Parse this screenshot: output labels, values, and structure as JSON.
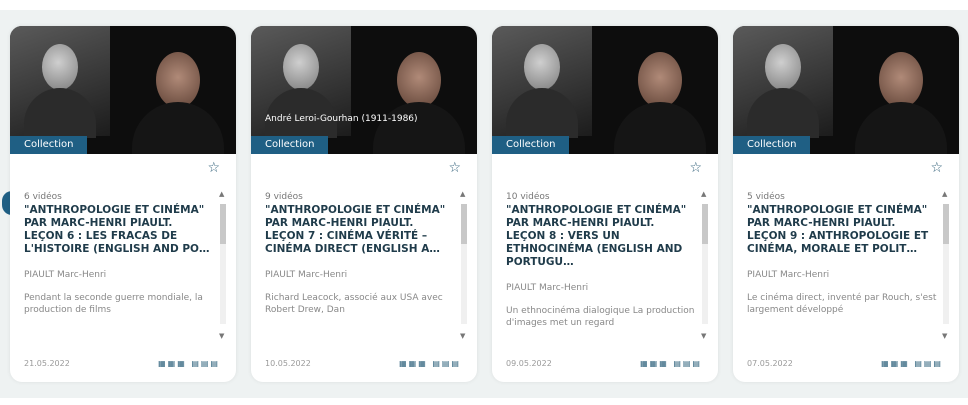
{
  "cards": [
    {
      "tag": "Collection",
      "caption": "",
      "count": "6 vidéos",
      "title": "\"ANTHROPOLOGIE ET CINÉMA\" PAR MARC-HENRI PIAULT. LEÇON 6 : LES FRACAS DE L'HISTOIRE (ENGLISH AND PO…",
      "author": "PIAULT Marc-Henri",
      "desc": "Pendant la seconde guerre mondiale, la production de films",
      "date": "21.05.2022"
    },
    {
      "tag": "Collection",
      "caption": "André Leroi-Gourhan (1911-1986)",
      "count": "9 vidéos",
      "title": "\"ANTHROPOLOGIE ET CINÉMA\" PAR MARC-HENRI PIAULT. LEÇON 7 : CINÉMA VÉRITÉ – CINÉMA DIRECT (ENGLISH A…",
      "author": "PIAULT Marc-Henri",
      "desc": "Richard Leacock, associé aux USA avec Robert Drew, Dan",
      "date": "10.05.2022"
    },
    {
      "tag": "Collection",
      "caption": "",
      "count": "10 vidéos",
      "title": "\"ANTHROPOLOGIE ET CINÉMA\" PAR MARC-HENRI PIAULT. LEÇON 8 : VERS UN ETHNOCINÉMA (ENGLISH AND PORTUGU…",
      "author": "PIAULT Marc-Henri",
      "desc": "Un ethnocinéma dialogique La production d'images met un regard",
      "date": "09.05.2022"
    },
    {
      "tag": "Collection",
      "caption": "",
      "count": "5 vidéos",
      "title": "\"ANTHROPOLOGIE ET CINÉMA\" PAR MARC-HENRI PIAULT. LEÇON 9 : ANTHROPOLOGIE ET CINÉMA, MORALE ET POLIT…",
      "author": "PIAULT Marc-Henri",
      "desc": "Le cinéma direct, inventé par Rouch, s'est largement développé",
      "date": "07.05.2022"
    }
  ],
  "icons": {
    "star": "star-icon",
    "nav": "chevron-left-icon",
    "meta": "media-icons"
  }
}
